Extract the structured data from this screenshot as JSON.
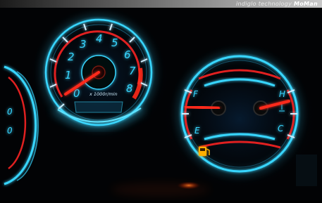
{
  "header": {
    "brand_text": "indiglo technology",
    "brand_mark": "MoMan"
  },
  "tachometer": {
    "numbers": [
      "0",
      "1",
      "2",
      "3",
      "4",
      "5",
      "6",
      "7",
      "8"
    ],
    "unit_label": "x 1000r/min"
  },
  "fuel_temp_gauge": {
    "fuel_full": "F",
    "fuel_empty": "E",
    "temp_hot": "H",
    "temp_cold": "C"
  },
  "left_partial_gauge": {
    "numbers": [
      "0",
      "0"
    ]
  },
  "colors": {
    "glow": "#37d6ff",
    "needle": "#ff2a1a",
    "redzone": "#e02020",
    "warning": "#ffb000"
  }
}
